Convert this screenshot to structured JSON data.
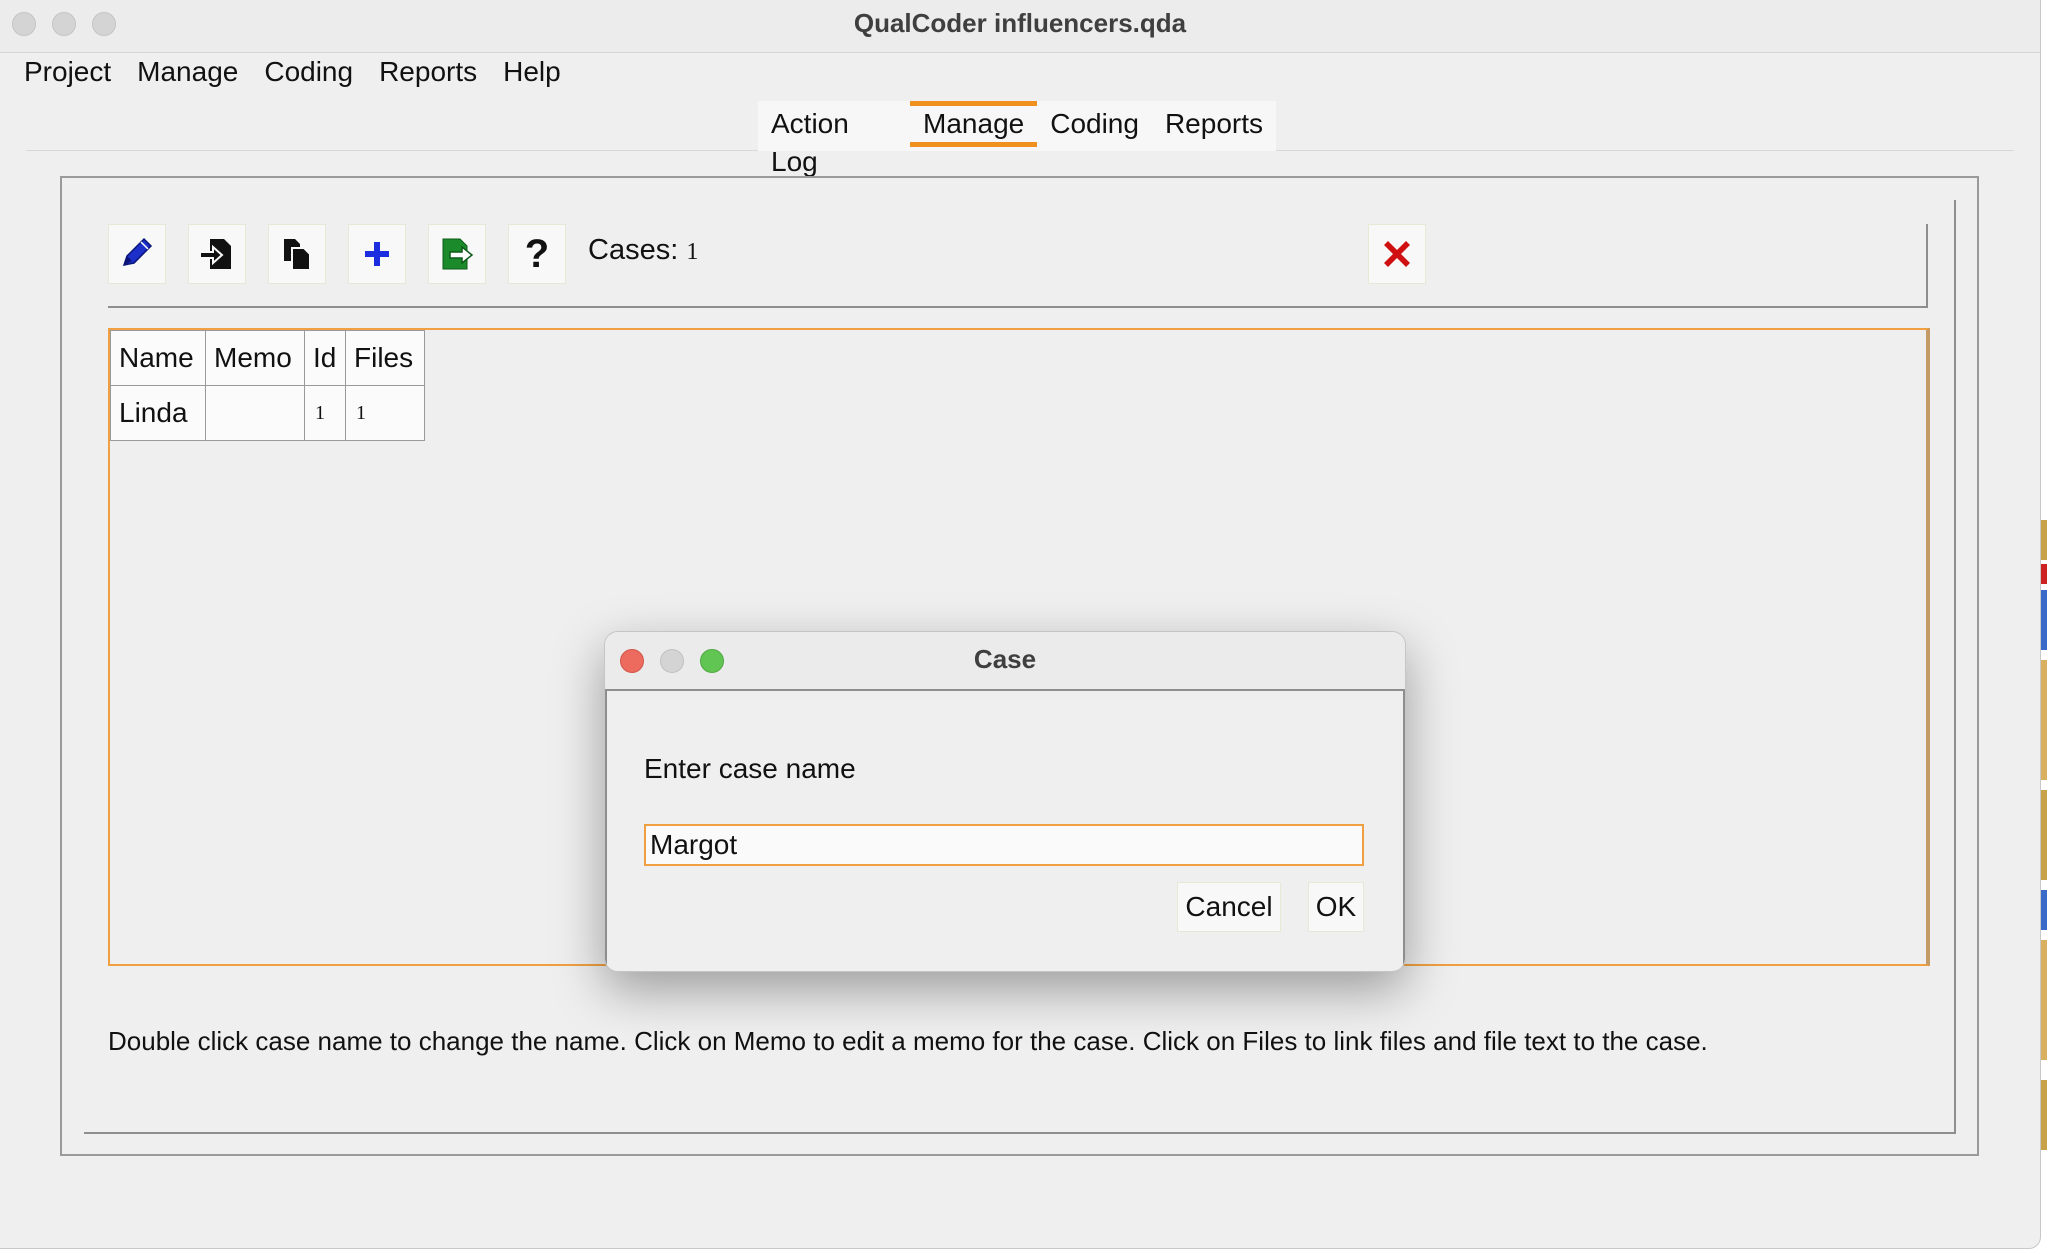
{
  "window": {
    "title": "QualCoder influencers.qda"
  },
  "menubar": {
    "items": [
      "Project",
      "Manage",
      "Coding",
      "Reports",
      "Help"
    ]
  },
  "tabs": {
    "items": [
      "Action Log",
      "Manage",
      "Coding",
      "Reports"
    ],
    "active": "Manage",
    "accent_color": "#f0901e"
  },
  "toolbar": {
    "icons": [
      "pencil-icon",
      "import-icon",
      "copy-icon",
      "plus-icon",
      "export-icon",
      "help-icon"
    ],
    "cases_label": "Cases:",
    "cases_count": "1",
    "delete_icon": "close-x-icon"
  },
  "table": {
    "columns": [
      "Name",
      "Memo",
      "Id",
      "Files"
    ],
    "rows": [
      {
        "name": "Linda",
        "memo": "",
        "id": "1",
        "files": "1"
      }
    ]
  },
  "hint_text": "Double click case name to change the name.  Click on Memo to edit a memo for the case.  Click on Files to link files and file text to the case.",
  "dialog": {
    "title": "Case",
    "prompt": "Enter case name",
    "input_value": "Margot",
    "cancel_label": "Cancel",
    "ok_label": "OK"
  }
}
